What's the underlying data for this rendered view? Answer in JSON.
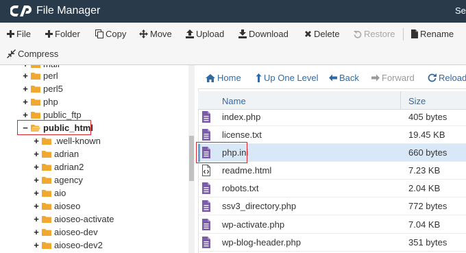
{
  "titlebar": {
    "title": "File Manager",
    "search_label": "Sea"
  },
  "toolbar": {
    "file": "File",
    "folder": "Folder",
    "copy": "Copy",
    "move": "Move",
    "upload": "Upload",
    "download": "Download",
    "delete": "Delete",
    "restore": "Restore",
    "rename": "Rename",
    "compress": "Compress"
  },
  "tree": {
    "items": [
      {
        "label": "mail",
        "sign": "+"
      },
      {
        "label": "perl",
        "sign": "+"
      },
      {
        "label": "perl5",
        "sign": "+"
      },
      {
        "label": "php",
        "sign": "+"
      },
      {
        "label": "public_ftp",
        "sign": "+"
      },
      {
        "label": "public_html",
        "sign": "−"
      },
      {
        "label": ".well-known",
        "sign": "+"
      },
      {
        "label": "adrian",
        "sign": "+"
      },
      {
        "label": "adrian2",
        "sign": "+"
      },
      {
        "label": "agency",
        "sign": "+"
      },
      {
        "label": "aio",
        "sign": "+"
      },
      {
        "label": "aioseo",
        "sign": "+"
      },
      {
        "label": "aioseo-activate",
        "sign": "+"
      },
      {
        "label": "aioseo-dev",
        "sign": "+"
      },
      {
        "label": "aioseo-dev2",
        "sign": "+"
      }
    ]
  },
  "nav": {
    "home": "Home",
    "up": "Up One Level",
    "back": "Back",
    "forward": "Forward",
    "reload": "Reload"
  },
  "table": {
    "col_name": "Name",
    "col_size": "Size",
    "rows": [
      {
        "name": "index.php",
        "size": "405 bytes",
        "type": "text"
      },
      {
        "name": "license.txt",
        "size": "19.45 KB",
        "type": "text"
      },
      {
        "name": "php.ini",
        "size": "660 bytes",
        "type": "text",
        "selected": true
      },
      {
        "name": "readme.html",
        "size": "7.23 KB",
        "type": "html"
      },
      {
        "name": "robots.txt",
        "size": "2.04 KB",
        "type": "text"
      },
      {
        "name": "ssv3_directory.php",
        "size": "772 bytes",
        "type": "text"
      },
      {
        "name": "wp-activate.php",
        "size": "7.04 KB",
        "type": "text"
      },
      {
        "name": "wp-blog-header.php",
        "size": "351 bytes",
        "type": "text"
      }
    ]
  },
  "colors": {
    "titlebar_bg": "#293a4a",
    "link_blue": "#2f6aa6",
    "folder_orange": "#f0a830",
    "file_purple": "#7b5ea7",
    "highlight_red": "#d9232d",
    "selected_row": "#d8e8f7"
  }
}
